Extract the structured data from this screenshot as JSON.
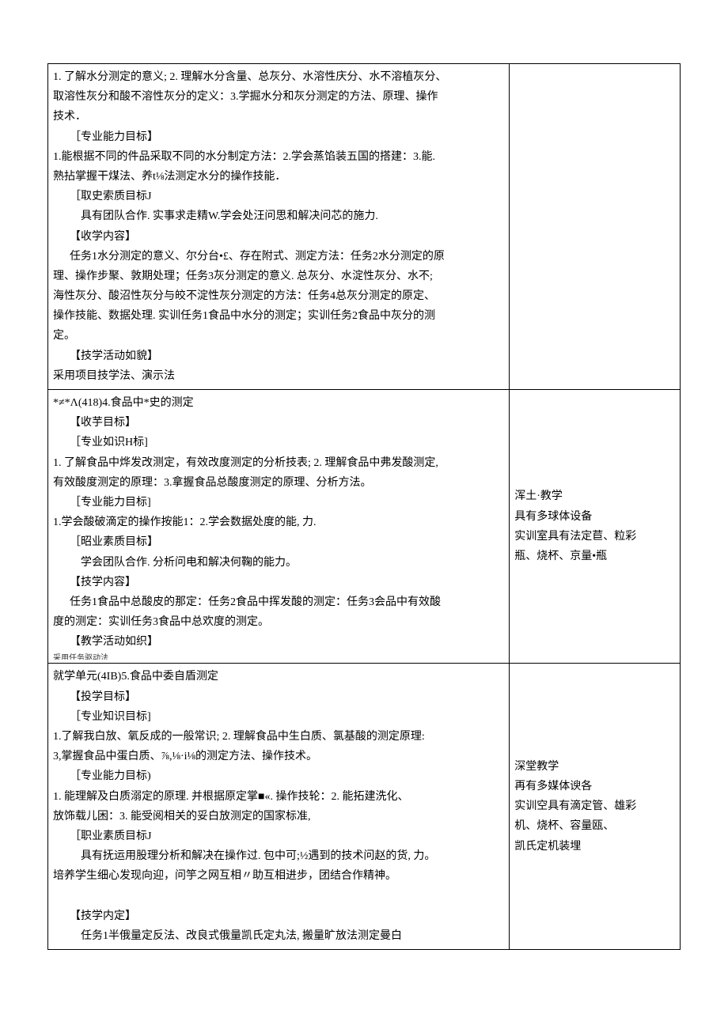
{
  "row1": {
    "main": {
      "p1": "1. 了解水分测定的意义; 2. 理解水分含量、总灰分、水溶性庆分、水不溶植灰分、",
      "p2": "取溶性灰分和酸不溶性灰分的定义：3.学掘水分和灰分测定的方法、原理、操作",
      "p3": "技术．",
      "p4": "［专业能力目标】",
      "p5": "1.能根据不同的件品采取不同的水分制定方法：2.学会蒸馅装五国的搭建：3.能.",
      "p6": "熟拈掌握干煤法、养t⅛法测定水分的操作技能．",
      "p7": "［取史索质目标J",
      "p8": "具有团队合作. 实事求走精W.学会处汪问思和解决问芯的施力.",
      "p9": "【收学内容】",
      "p10": "任务1水分测定的意义、尔分台•£、存在附式、测定方法：任务2水分测定的原",
      "p11": "理、操作步聚、敦期处理；任务3灰分测定的意义. 总灰分、水淀性灰分、水不;",
      "p12": "海性灰分、酸沼性灰分与皎不淀性灰分测定的方法：任务4总灰分测定的原定、",
      "p13": "操作技能、数据处理. 实训任务1食品中水分的测定；实训任务2食品中灰分的测",
      "p14": "定。",
      "p15": "【技学活动如貌】",
      "p16": "采用项目技学法、演示法"
    },
    "side": ""
  },
  "row2": {
    "main": {
      "p1": "*≠*Λ(418)4.食品中*史的测定",
      "p2": "【收芋目标】",
      "p3": "［专业如识H标]",
      "p4": "1. 了解食品中烨发改测定，有效改度测定的分析技表; 2. 理解食品中弗发酸测定,",
      "p5": "有效酸度测定的原理：3.拿握食品总酸度测定的原理、分析方法。",
      "p6": "［专业能力目标]",
      "p7": "1.学会酸破滴定的操作按能1：2.学会数据处度的能, 力.",
      "p8": "［昭业素质目标】",
      "p9": "学会团队合作. 分析问电和解决何鞠的能力。",
      "p10": "【技学内容】",
      "p11": "任务1食品中总酸皮的那定：任务2食品中挥发酸的测定：任务3会品中有效酸",
      "p12": "度的测定：实训任务3食品中总欢度的测定。",
      "p13": "【教学活动如织】",
      "p14": "采用任务驱动法"
    },
    "side": {
      "p1": "浑土·教学",
      "p2": "具有多球体设备",
      "p3": "实训室具有法定苣、粒彩",
      "p4": "瓶、烧杯、京量•瓶"
    }
  },
  "row3": {
    "main": {
      "p1": "就学单元(4IB)5.食品中委自盾测定",
      "p2": "【投学目标】",
      "p3": "［专业知识目标]",
      "p4": "1.了解我白放、氧反成的一般常识; 2. 理解食品中生白质、氯基酸的测定原理:",
      "p5": "3,掌握食品中蛋白质、⅞,⅛·i⅛的测定方法、操作技术。",
      "p6": "［专业能力目标)",
      "p7": "1. 能理解及白质溺定的原理. 并根据原定掌■«. 操作技轮：2. 能拓建洗化、",
      "p8": "放饰载儿困：3. 能受阅相关的妥白放测定的国家标准,",
      "p9": "［职业素质目标J",
      "p10": "具有抚运用股理分析和解决在操作过. 包中可;½遇到的技术问赵的货, 力。",
      "p11": "培养学生细心发现向迎，问竽之网互相〃助互相进步，团结合作精神。",
      "p12": "",
      "p13": "【技学内定】",
      "p14": "任务1半俄量定反法、改良式俄量凯氏定丸法, 搬量旷放法测定曼白"
    },
    "side": {
      "p1": "深堂教学",
      "p2": "再有多媒体谀各",
      "p3": "实训空具有滴定管、雄彩",
      "p4": "机、烧杯、容量瓯、",
      "p5": "凯氏定机装埋"
    }
  }
}
